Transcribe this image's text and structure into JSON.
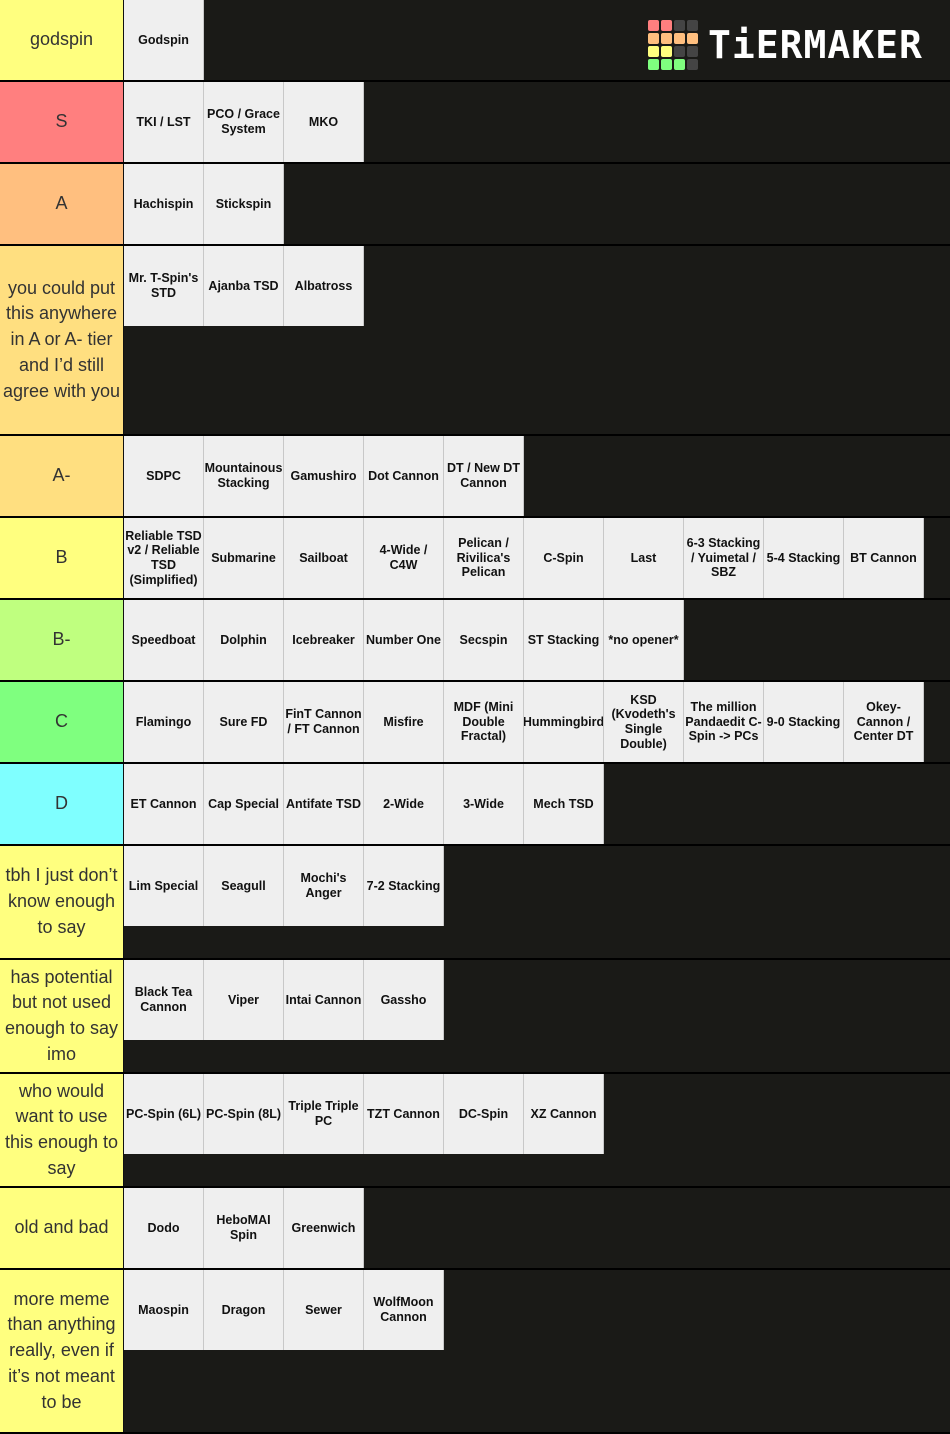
{
  "logo": {
    "text": "TiERMAKER",
    "grid_colors": [
      "#ff7f7f",
      "#ff7f7f",
      "#444444",
      "#444444",
      "#ffbf7f",
      "#ffbf7f",
      "#ffbf7f",
      "#ffbf7f",
      "#ffff7f",
      "#ffff7f",
      "#444444",
      "#444444",
      "#7fff7f",
      "#7fff7f",
      "#7fff7f",
      "#444444"
    ]
  },
  "tiers": [
    {
      "label": "godspin",
      "color": "#ffff7f",
      "items": [
        "Godspin"
      ]
    },
    {
      "label": "S",
      "color": "#ff7f7f",
      "items": [
        "TKI / LST",
        "PCO / Grace System",
        "MKO"
      ]
    },
    {
      "label": "A",
      "color": "#ffbf7f",
      "items": [
        "Hachispin",
        "Stickspin"
      ]
    },
    {
      "label": "you could put this anywhere in A or A- tier and I’d still agree with you",
      "color": "#ffdf80",
      "items": [
        "Mr. T-Spin's STD",
        "Ajanba TSD",
        "Albatross"
      ]
    },
    {
      "label": "A-",
      "color": "#ffdf80",
      "items": [
        "SDPC",
        "Mountainous Stacking",
        "Gamushiro",
        "Dot Cannon",
        "DT / New DT Cannon"
      ]
    },
    {
      "label": "B",
      "color": "#ffff7f",
      "items": [
        "Reliable TSD v2 / Reliable TSD (Simplified)",
        "Submarine",
        "Sailboat",
        "4-Wide / C4W",
        "Pelican / Rivilica's Pelican",
        "C-Spin",
        "Last",
        "6-3 Stacking / Yuimetal / SBZ",
        "5-4 Stacking",
        "BT Cannon"
      ]
    },
    {
      "label": "B-",
      "color": "#bfff7f",
      "items": [
        "Speedboat",
        "Dolphin",
        "Icebreaker",
        "Number One",
        "Secspin",
        "ST Stacking",
        "*no opener*"
      ]
    },
    {
      "label": "C",
      "color": "#7fff7f",
      "items": [
        "Flamingo",
        "Sure FD",
        "FinT Cannon / FT Cannon",
        "Misfire",
        "MDF (Mini Double Fractal)",
        "Hummingbird",
        "KSD (Kvodeth's Single Double)",
        "The million Pandaedit C-Spin -> PCs",
        "9-0 Stacking",
        "Okey-Cannon / Center DT"
      ]
    },
    {
      "label": "D",
      "color": "#7fffff",
      "items": [
        "ET Cannon",
        "Cap Special",
        "Antifate TSD",
        "2-Wide",
        "3-Wide",
        "Mech TSD"
      ]
    },
    {
      "label": "tbh I just don’t know enough to say",
      "color": "#ffff7f",
      "items": [
        "Lim Special",
        "Seagull",
        "Mochi's Anger",
        "7-2 Stacking"
      ]
    },
    {
      "label": "has potential but not used enough to say imo",
      "color": "#ffff7f",
      "items": [
        "Black Tea Cannon",
        "Viper",
        "Intai Cannon",
        "Gassho"
      ]
    },
    {
      "label": "who would want to use this enough to say",
      "color": "#ffff7f",
      "items": [
        "PC-Spin (6L)",
        "PC-Spin (8L)",
        "Triple Triple PC",
        "TZT Cannon",
        "DC-Spin",
        "XZ Cannon"
      ]
    },
    {
      "label": "old and bad",
      "color": "#ffff7f",
      "items": [
        "Dodo",
        "HeboMAI Spin",
        "Greenwich"
      ]
    },
    {
      "label": "more meme than anything really, even if it’s not meant to be",
      "color": "#ffff7f",
      "items": [
        "Maospin",
        "Dragon",
        "Sewer",
        "WolfMoon Cannon"
      ]
    }
  ]
}
